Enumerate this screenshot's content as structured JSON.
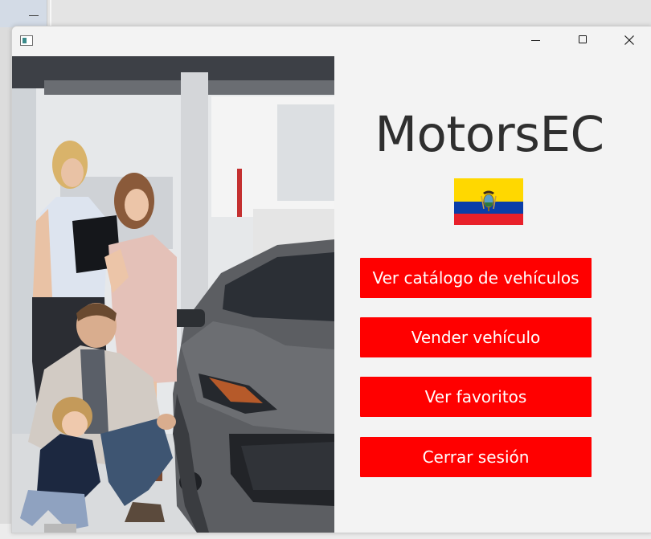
{
  "background": {
    "taskbar_glyph": "minimize-glyph"
  },
  "window": {
    "icon": "app-window-icon",
    "controls": {
      "minimize": "minimize-icon",
      "maximize": "maximize-icon",
      "close": "close-icon"
    }
  },
  "hero_image": {
    "depicts": "car-dealership-family-photo"
  },
  "brand": {
    "title": "MotorsEC",
    "flag_icon": "ecuador-flag-icon"
  },
  "menu": {
    "catalog_label": "Ver catálogo de vehículos",
    "sell_label": "Vender vehículo",
    "favorites_label": "Ver favoritos",
    "logout_label": "Cerrar sesión"
  },
  "colors": {
    "button_bg": "#ff0000",
    "button_text": "#ffffff",
    "title_text": "#2f2f2f",
    "window_bg": "#f3f3f3",
    "flag_yellow": "#ffd800",
    "flag_blue": "#0b3ea8",
    "flag_red": "#e8202a"
  }
}
